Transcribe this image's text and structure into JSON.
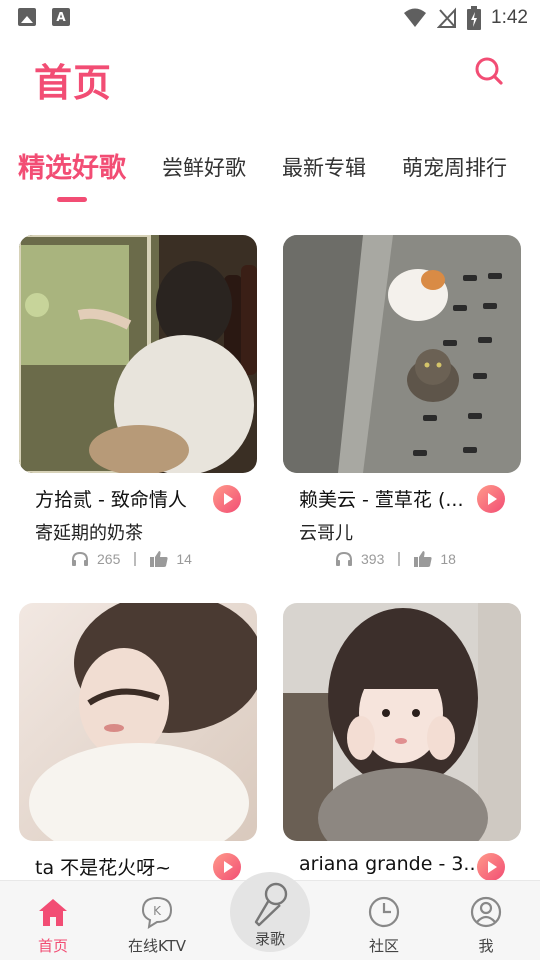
{
  "status_bar": {
    "time": "1:42",
    "a_icon_letter": "A"
  },
  "header": {
    "title": "首页"
  },
  "tabs": [
    {
      "label": "精选好歌",
      "active": true
    },
    {
      "label": "尝鲜好歌",
      "active": false
    },
    {
      "label": "最新专辑",
      "active": false
    },
    {
      "label": "萌宠周排行",
      "active": false
    }
  ],
  "cards": [
    {
      "title": "方拾贰 - 致命情人",
      "artist": "寄延期的奶茶",
      "listens": "265",
      "likes": "14",
      "cover": "girl-at-fridge"
    },
    {
      "title": "赖美云 - 萱草花 (...",
      "artist": "云哥儿",
      "listens": "393",
      "likes": "18",
      "cover": "cats-on-street"
    },
    {
      "title": "ta 不是花火呀~",
      "artist": "",
      "listens": "",
      "likes": "",
      "cover": "girl-soft-portrait"
    },
    {
      "title": "ariana grande - 3...",
      "artist": "",
      "listens": "",
      "likes": "",
      "cover": "girl-hands-on-cheeks"
    }
  ],
  "bottom_nav": {
    "home": "首页",
    "ktv": "在线KTV",
    "record": "录歌",
    "community": "社区",
    "me": "我"
  },
  "colors": {
    "accent": "#f24d74",
    "nav_bg": "#f6f6f6"
  }
}
